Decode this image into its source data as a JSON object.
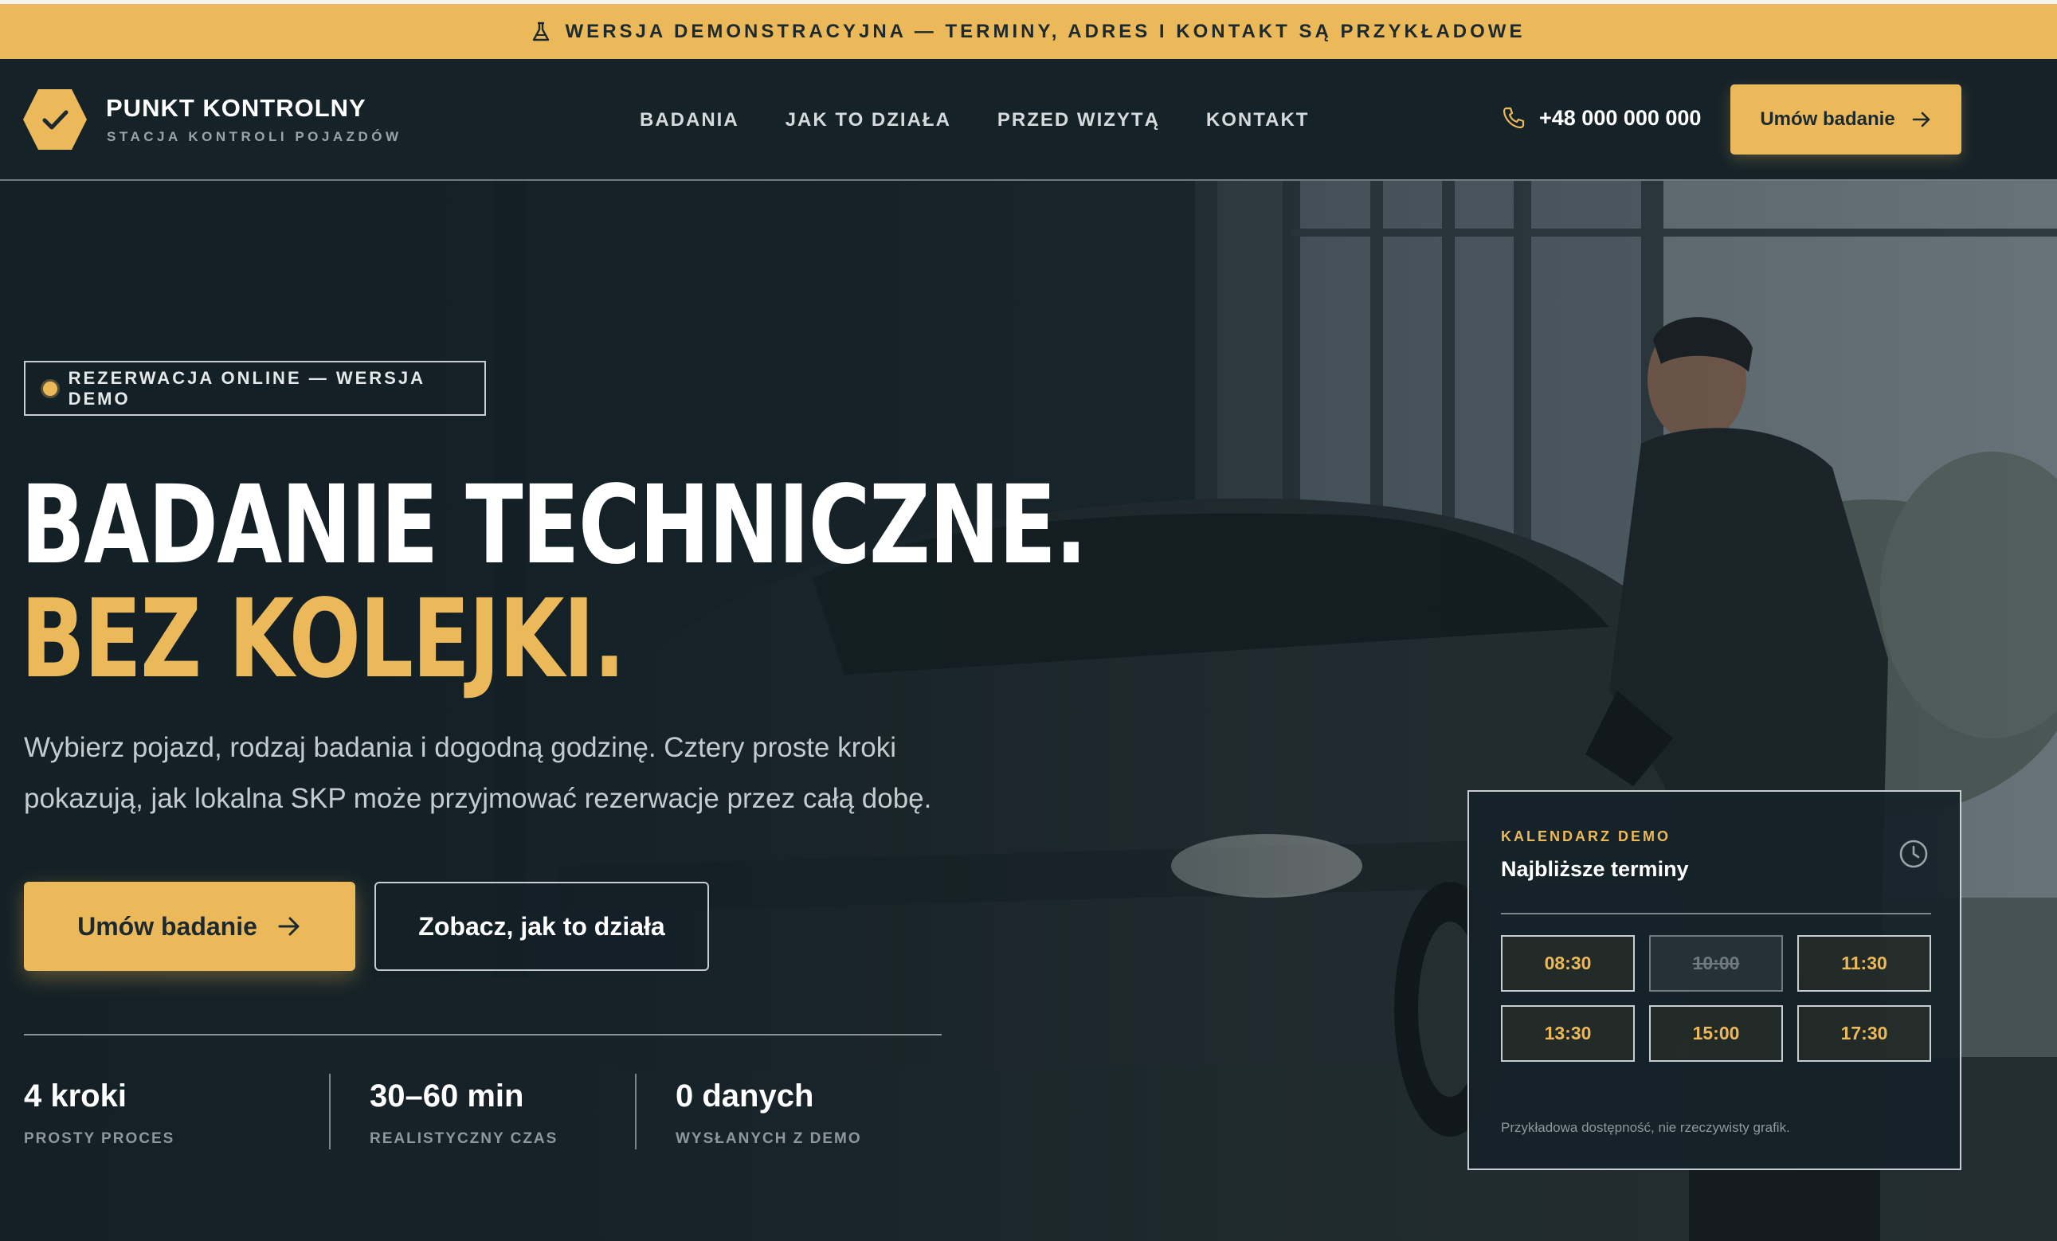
{
  "banner": {
    "icon": "flask-icon",
    "text": "WERSJA DEMONSTRACYJNA — TERMINY, ADRES I KONTAKT SĄ PRZYKŁADOWE"
  },
  "brand": {
    "name": "PUNKT KONTROLNY",
    "subtitle": "STACJA KONTROLI POJAZDÓW",
    "icon": "check-icon"
  },
  "nav": {
    "links": [
      "BADANIA",
      "JAK TO DZIAŁA",
      "PRZED WIZYTĄ",
      "KONTAKT"
    ]
  },
  "phone": {
    "icon": "phone-icon",
    "number": "+48 000 000 000"
  },
  "nav_cta": {
    "label": "Umów badanie",
    "icon": "arrow-right-icon"
  },
  "hero": {
    "pill": "REZERWACJA ONLINE — WERSJA DEMO",
    "headline_1": "BADANIE TECHNICZNE.",
    "headline_2": "BEZ KOLEJKI.",
    "lead": "Wybierz pojazd, rodzaj badania i dogodną godzinę. Cztery proste kroki pokazują, jak lokalna SKP może przyjmować rezerwacje przez całą dobę.",
    "primary_cta": "Umów badanie",
    "secondary_cta": "Zobacz, jak to działa",
    "stats": [
      {
        "value": "4 kroki",
        "label": "PROSTY PROCES"
      },
      {
        "value": "30–60 min",
        "label": "REALISTYCZNY CZAS"
      },
      {
        "value": "0 danych",
        "label": "WYSŁANYCH Z DEMO"
      }
    ]
  },
  "calendar": {
    "kicker": "KALENDARZ DEMO",
    "title": "Najbliższe terminy",
    "icon": "clock-icon",
    "slots": [
      {
        "time": "08:30",
        "available": true
      },
      {
        "time": "10:00",
        "available": false
      },
      {
        "time": "11:30",
        "available": true
      },
      {
        "time": "13:30",
        "available": true
      },
      {
        "time": "15:00",
        "available": true
      },
      {
        "time": "17:30",
        "available": true
      }
    ],
    "note": "Przykładowa dostępność, nie rzeczywisty grafik."
  },
  "colors": {
    "accent": "#ecb95a",
    "background": "#121f25",
    "text": "#ffffff",
    "muted": "#8e989c"
  }
}
